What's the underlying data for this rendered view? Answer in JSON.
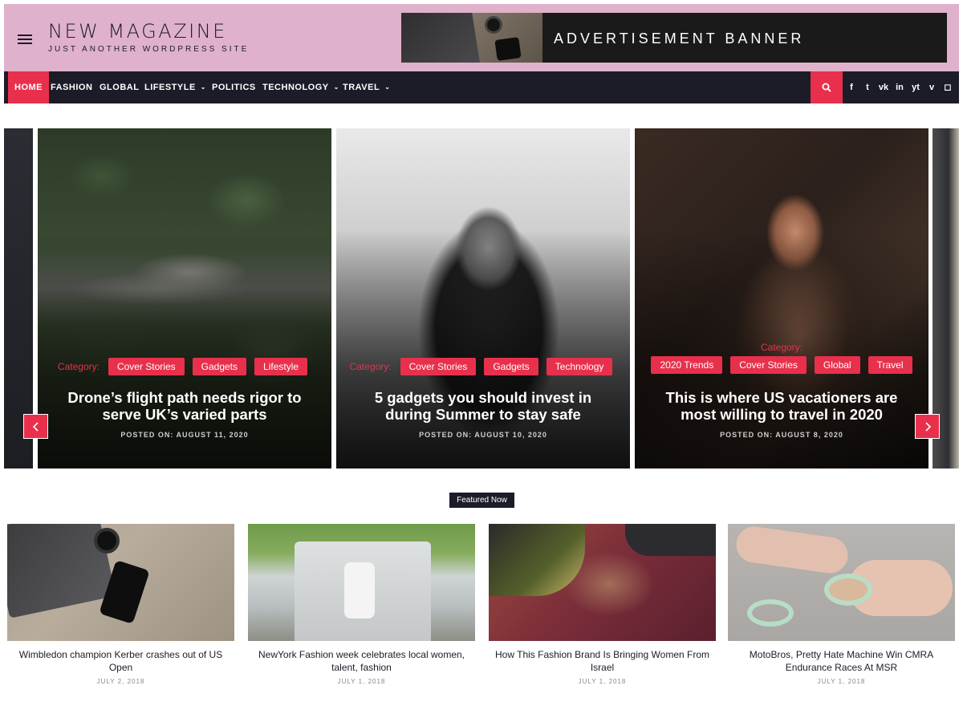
{
  "site": {
    "title": "NEW MAGAZINE",
    "tagline": "JUST ANOTHER WORDPRESS SITE"
  },
  "ad": {
    "text": "ADVERTISEMENT BANNER"
  },
  "nav": {
    "items": [
      {
        "label": "HOME",
        "active": true,
        "dropdown": false
      },
      {
        "label": "FASHION",
        "dropdown": false
      },
      {
        "label": "GLOBAL",
        "dropdown": false
      },
      {
        "label": "LIFESTYLE",
        "dropdown": true
      },
      {
        "label": "POLITICS",
        "dropdown": false
      },
      {
        "label": "TECHNOLOGY",
        "dropdown": true
      },
      {
        "label": "TRAVEL",
        "dropdown": true
      }
    ],
    "caret": "⌄",
    "social": [
      {
        "icon": "facebook-icon",
        "glyph": "f"
      },
      {
        "icon": "twitter-icon",
        "glyph": "t"
      },
      {
        "icon": "vk-icon",
        "glyph": "vk"
      },
      {
        "icon": "linkedin-icon",
        "glyph": "in"
      },
      {
        "icon": "youtube-icon",
        "glyph": "yt"
      },
      {
        "icon": "vimeo-icon",
        "glyph": "v"
      },
      {
        "icon": "instagram-icon",
        "glyph": "◻"
      }
    ]
  },
  "slider": {
    "category_label": "Category:",
    "slides": [
      {
        "categories": [
          "Cover Stories",
          "Gadgets",
          "Lifestyle"
        ],
        "title": "Drone’s flight path needs rigor to serve UK’s varied parts",
        "date": "POSTED ON: AUGUST 11, 2020"
      },
      {
        "categories": [
          "Cover Stories",
          "Gadgets",
          "Technology"
        ],
        "title": "5 gadgets you should invest in during Summer to stay safe",
        "date": "POSTED ON: AUGUST 10, 2020"
      },
      {
        "categories": [
          "2020 Trends",
          "Cover Stories",
          "Global",
          "Travel"
        ],
        "title": "This is where US vacationers are most willing to travel in 2020",
        "date": "POSTED ON: AUGUST 8, 2020"
      }
    ]
  },
  "featured": {
    "label": "Featured Now",
    "cards": [
      {
        "title": "Wimbledon champion Kerber crashes out of US Open",
        "date": "JULY 2, 2018"
      },
      {
        "title": "NewYork Fashion week celebrates local women, talent, fashion",
        "date": "JULY 1, 2018"
      },
      {
        "title": "How This Fashion Brand Is Bringing Women From Israel",
        "date": "JULY 1, 2018"
      },
      {
        "title": "MotoBros, Pretty Hate Machine Win CMRA Endurance Races At MSR",
        "date": "JULY 1, 2018"
      }
    ]
  },
  "colors": {
    "accent": "#e8304c",
    "header_bg": "#e0b1cb",
    "nav_bg": "#1c1c28"
  }
}
